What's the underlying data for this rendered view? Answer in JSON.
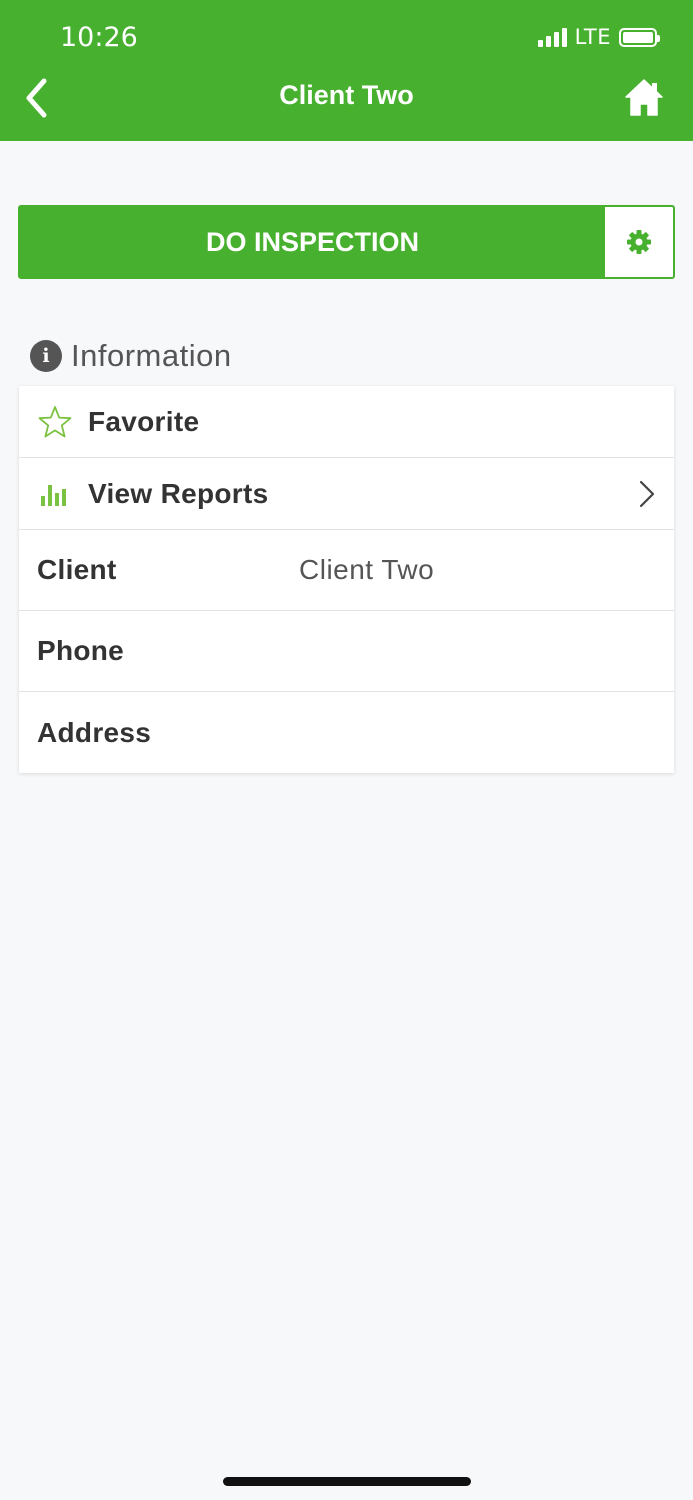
{
  "status_bar": {
    "time": "10:26",
    "network": "LTE",
    "battery_level": 1.0
  },
  "nav": {
    "title": "Client Two",
    "back_icon": "chevron-left-icon",
    "home_icon": "home-icon"
  },
  "action": {
    "primary_label": "DO INSPECTION",
    "settings_icon": "gear-icon"
  },
  "section": {
    "icon": "info-icon",
    "icon_glyph": "i",
    "title": "Information"
  },
  "rows": {
    "favorite": {
      "icon": "star-icon",
      "label": "Favorite"
    },
    "reports": {
      "icon": "bar-chart-icon",
      "label": "View Reports",
      "chevron": "chevron-right-icon"
    },
    "client": {
      "label": "Client",
      "value": "Client Two"
    },
    "phone": {
      "label": "Phone",
      "value": ""
    },
    "address": {
      "label": "Address",
      "value": ""
    }
  },
  "colors": {
    "brand_green": "#47b12f",
    "icon_green": "#7cc242",
    "text_dark": "#333333",
    "text_mid": "#555555"
  }
}
